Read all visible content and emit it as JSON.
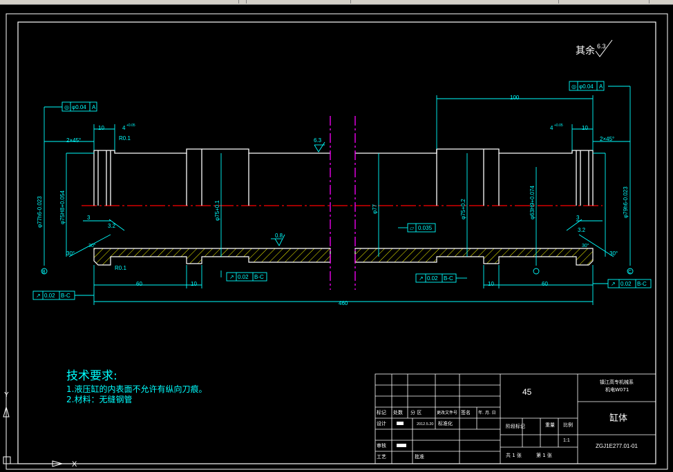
{
  "toolbar": {
    "colors": {
      "bar": "#d4d0c8"
    }
  },
  "surface_finish": {
    "prefix": "其余",
    "value": "6.3"
  },
  "tolerances": {
    "concentricity_left": {
      "symbol": "◎",
      "value": "φ0.04",
      "datum": "A"
    },
    "concentricity_right": {
      "symbol": "◎",
      "value": "φ0.04",
      "datum": "A"
    },
    "runout_left": {
      "value": "0.02",
      "datum": "B-C"
    },
    "runout_mid_left": {
      "value": "0.02",
      "datum": "B-C"
    },
    "runout_mid_right": {
      "value": "0.02",
      "datum": "B-C"
    },
    "runout_right": {
      "value": "0.02",
      "datum": "B-C"
    },
    "flatness": {
      "value": "0.035"
    }
  },
  "dimensions": {
    "overall_length": "460",
    "left_60": "60",
    "right_60": "60",
    "left_10_bottom": "10",
    "right_10_bottom": "10",
    "right_100": "100",
    "left_10_top": "10",
    "right_10_top": "10",
    "left_chamfer": "2×45°",
    "right_chamfer": "2×45°",
    "left_4": "4",
    "left_4_tol": "+0.05",
    "right_4": "4",
    "right_4_tol": "+0.05",
    "left_r": "R0.1",
    "left_r_bottom": "R0.1",
    "left_dia_outer": "φ77h6-0.023",
    "right_dia_outer": "φ79h6-0.023",
    "left_dia_bore": "φ75H8+0.054",
    "right_dia_bore": "φ63H9+0.074",
    "left_dia_75": "φ75+0.1",
    "right_dia_75": "φ75+0.2",
    "center_dia": "φ77",
    "left_3": "3",
    "right_3": "3",
    "left_angle": "30°",
    "right_angle": "30°",
    "left_inner_angle": "30°",
    "right_inner_angle": "30°",
    "roughness_top": "6.3",
    "roughness_mid": "0.8",
    "roughness_left": "3.2",
    "roughness_right": "3.2",
    "datum_b": "B",
    "datum_c": "C"
  },
  "tech_requirements": {
    "title": "技术要求:",
    "items": [
      "1.液压缸的内表面不允许有纵向刀痕。",
      "2.材料：无缝钢管"
    ]
  },
  "title_block": {
    "material": "45",
    "school": "镇江高专机械系",
    "class": "机电W071",
    "part_name": "缸体",
    "drawing_no": "ZGJ1E277.01-01",
    "row_labels": [
      "标记",
      "处数",
      "分 区",
      "更改文件号",
      "签名",
      "年. 月. 日"
    ],
    "design_label": "设计",
    "design_date": "2012.5.20",
    "standardize_label": "标准化",
    "stage_label": "阶段标记",
    "weight_label": "重量",
    "scale_label": "比例",
    "scale_value": "1:1",
    "review_label": "审核",
    "process_label": "工艺",
    "approve_label": "批准",
    "sheets": "共 1 张",
    "sheet": "第 1 张"
  },
  "ucs": {
    "x_label": "X",
    "y_label": "Y"
  },
  "colors": {
    "background": "#000000",
    "outline": "#ffffff",
    "dimension": "#00ffff",
    "hatch": "#ffff00",
    "centerline": "#ff0000",
    "breakline": "#ff00ff"
  }
}
